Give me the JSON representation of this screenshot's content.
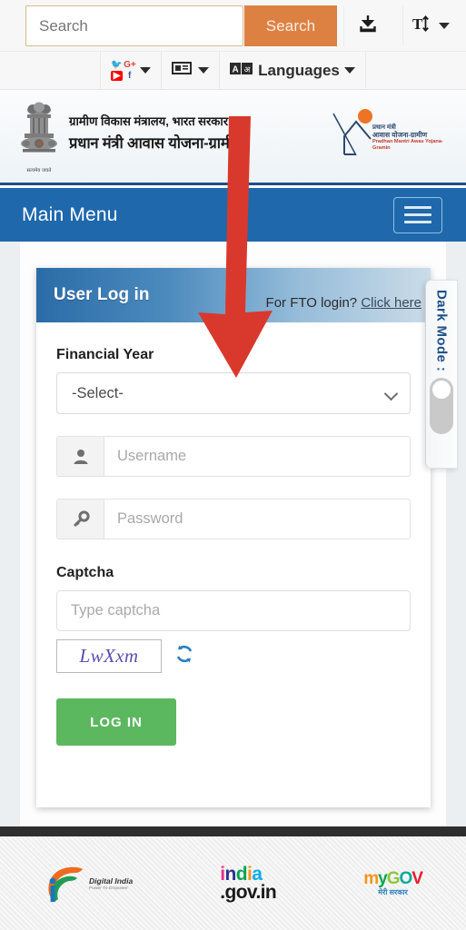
{
  "toolbar": {
    "search_placeholder": "Search",
    "search_button_label": "Search",
    "download_icon": "download-icon",
    "textsize_icon": "text-size-icon"
  },
  "toolbar2": {
    "social_icon": "social-media-icon",
    "news_icon": "newspaper-icon",
    "translate_icon": "translate-icon",
    "languages_label": "Languages"
  },
  "header": {
    "emblem_caption": "सत्यमेव जयते",
    "ministry_line1": "ग्रामीण विकास मंत्रालय, भारत सरकार",
    "ministry_line2": "प्रधान मंत्री आवास योजना-ग्रामीण",
    "pmayg_line1": "प्रधान मंत्री",
    "pmayg_line2": "आवास योजना-ग्रामीण",
    "pmayg_line3": "Pradhan Mantri Awas Yojana-Gramin"
  },
  "mainmenu": {
    "title": "Main Menu",
    "hamburger_icon": "hamburger-menu-icon"
  },
  "login": {
    "card_title": "User Log in",
    "fto_text": "For FTO login?",
    "fto_link": "Click here",
    "financial_year_label": "Financial Year",
    "financial_year_value": "-Select-",
    "username_placeholder": "Username",
    "username_value": "",
    "user_icon": "user-icon",
    "password_placeholder": "Password",
    "password_value": "",
    "key_icon": "key-icon",
    "captcha_label": "Captcha",
    "captcha_placeholder": "Type captcha",
    "captcha_value": "",
    "captcha_text": "LwXxm",
    "refresh_icon": "refresh-icon",
    "login_button_label": "LOG IN"
  },
  "darkmode": {
    "label": "Dark Mode :",
    "state": "off"
  },
  "annotation": {
    "type": "down-arrow",
    "color": "#d9392c",
    "points_to": "financial-year-select"
  },
  "footer": {
    "logos": [
      {
        "name": "digital-india-logo",
        "line1": "Digital India",
        "line2": "Power To Empower"
      },
      {
        "name": "india-gov-in-logo",
        "line1": "india",
        "line2": ".gov.in"
      },
      {
        "name": "mygov-logo",
        "line1": "myGOV",
        "line2": "मेरी सरकार"
      }
    ]
  },
  "colors": {
    "brand_blue": "#1f68ac",
    "search_orange": "#dd8143",
    "login_green": "#5cb85f",
    "arrow_red": "#d9392c"
  }
}
